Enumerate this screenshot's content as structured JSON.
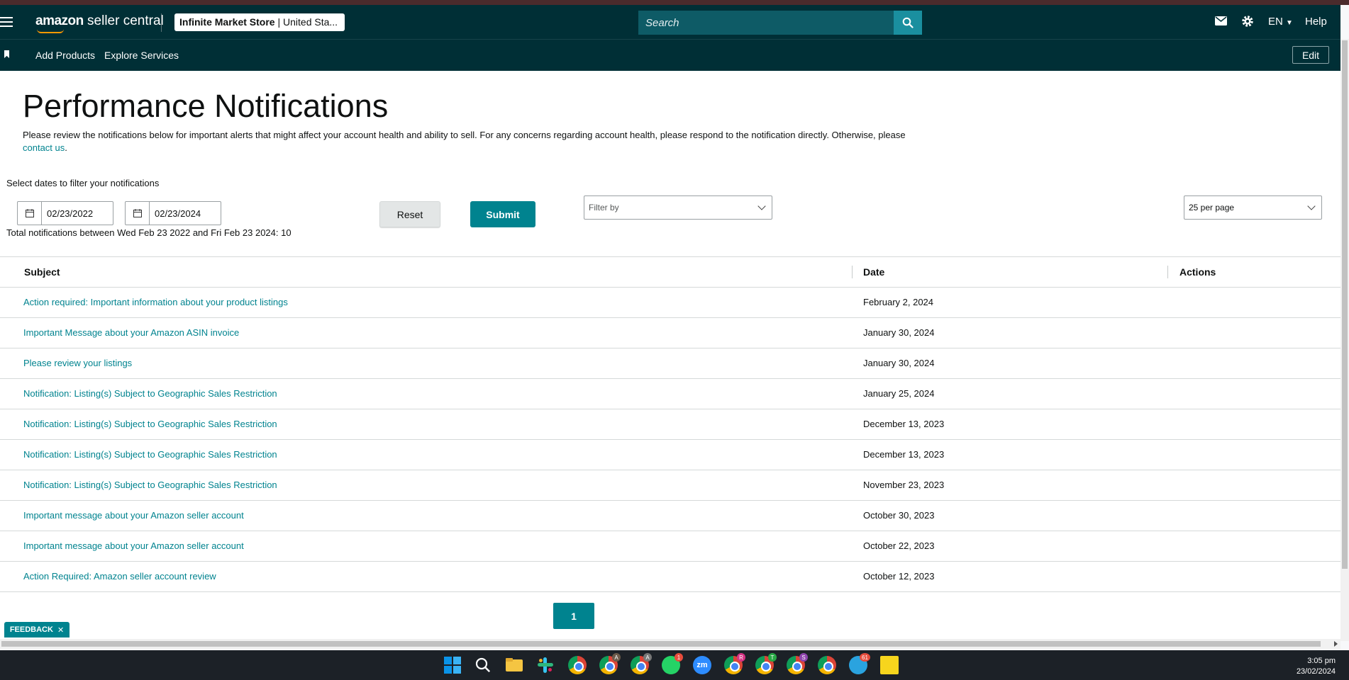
{
  "topbar": {
    "logo_bold": "amazon",
    "logo_rest": " seller central",
    "store_name": "Infinite Market Store",
    "store_region": " | United Sta...",
    "search_placeholder": "Search",
    "language": "EN",
    "help": "Help"
  },
  "navbar": {
    "links": [
      "Add Products",
      "Explore Services"
    ],
    "edit": "Edit"
  },
  "page": {
    "title": "Performance Notifications",
    "intro_text": "Please review the notifications below for important alerts that might affect your account health and ability to sell. For any concerns regarding account health, please respond to the notification directly. Otherwise, please ",
    "intro_link": "contact us",
    "intro_end": ".",
    "filter_label": "Select dates to filter your notifications",
    "date_from": "02/23/2022",
    "date_to": "02/23/2024",
    "reset_label": "Reset",
    "submit_label": "Submit",
    "filter_placeholder": "Filter by",
    "per_page": "25 per page",
    "total_text": "Total notifications between Wed Feb 23 2022 and Fri Feb 23 2024: 10"
  },
  "table": {
    "headers": [
      "Subject",
      "Date",
      "Actions"
    ],
    "rows": [
      {
        "subject": "Action required: Important information about your product listings",
        "date": "February 2, 2024"
      },
      {
        "subject": "Important Message about your Amazon ASIN invoice",
        "date": "January 30, 2024"
      },
      {
        "subject": "Please review your listings",
        "date": "January 30, 2024"
      },
      {
        "subject": "Notification: Listing(s) Subject to Geographic Sales Restriction",
        "date": "January 25, 2024"
      },
      {
        "subject": "Notification: Listing(s) Subject to Geographic Sales Restriction",
        "date": "December 13, 2023"
      },
      {
        "subject": "Notification: Listing(s) Subject to Geographic Sales Restriction",
        "date": "December 13, 2023"
      },
      {
        "subject": "Notification: Listing(s) Subject to Geographic Sales Restriction",
        "date": "November 23, 2023"
      },
      {
        "subject": "Important message about your Amazon seller account",
        "date": "October 30, 2023"
      },
      {
        "subject": "Important message about your Amazon seller account",
        "date": "October 22, 2023"
      },
      {
        "subject": "Action Required: Amazon seller account review",
        "date": "October 12, 2023"
      }
    ]
  },
  "pagination": {
    "current": "1"
  },
  "feedback": {
    "label": "FEEDBACK",
    "close": "✕"
  },
  "taskbar": {
    "time": "3:05 pm",
    "date": "23/02/2024",
    "badges": {
      "a1": "A",
      "a2": "A",
      "whatsapp": "1",
      "zoom": "zm",
      "r": "R",
      "t": "T",
      "s": "S",
      "telegram": "61"
    },
    "icons": [
      "windows-start-icon",
      "search-icon",
      "file-explorer-icon",
      "slack-icon",
      "chrome-icon",
      "chrome-icon",
      "chrome-icon",
      "whatsapp-icon",
      "zoom-icon",
      "chrome-icon",
      "chrome-icon",
      "chrome-icon",
      "chrome-icon",
      "telegram-icon",
      "sticky-notes-icon"
    ]
  },
  "colors": {
    "header_bg": "#002f36",
    "accent": "#00838f",
    "link": "#00838f"
  }
}
